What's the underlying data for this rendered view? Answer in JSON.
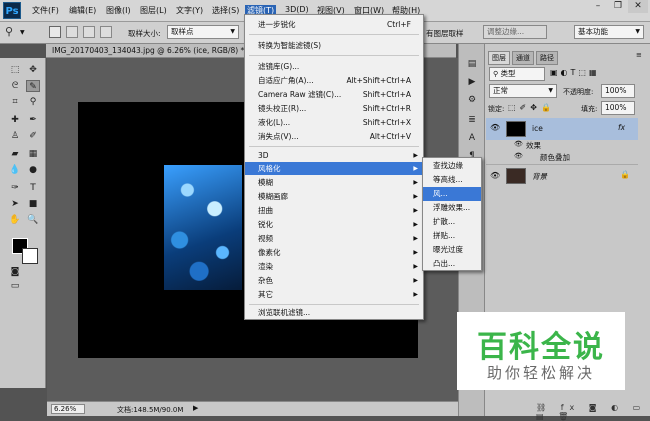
{
  "app": {
    "logo": "Ps"
  },
  "menubar": {
    "items": [
      "文件(F)",
      "编辑(E)",
      "图像(I)",
      "图层(L)",
      "文字(Y)",
      "选择(S)",
      "滤镜(T)",
      "3D(D)",
      "视图(V)",
      "窗口(W)",
      "帮助(H)"
    ],
    "active_index": 6,
    "window_controls": [
      "minimize-icon",
      "restore-icon",
      "close-icon"
    ]
  },
  "options_bar": {
    "sample_size_label": "取样大小:",
    "sample_size_value": "取样点",
    "all_layers_label": "有图层取样",
    "adjust_edge": "调整边缘...",
    "workspace": "基本功能"
  },
  "document": {
    "tab_title": "IMG_20170403_134043.jpg @ 6.26% (ice, RGB/8) *"
  },
  "status": {
    "zoom": "6.26%",
    "doc_info": "文档:148.5M/90.0M"
  },
  "filter_menu": {
    "items": [
      {
        "label": "进一步锐化",
        "shortcut": "Ctrl+F"
      },
      {
        "label": "转换为智能滤镜(S)",
        "shortcut": ""
      },
      {
        "label": "滤镜库(G)...",
        "shortcut": ""
      },
      {
        "label": "自适应广角(A)...",
        "shortcut": "Alt+Shift+Ctrl+A"
      },
      {
        "label": "Camera Raw 滤镜(C)...",
        "shortcut": "Shift+Ctrl+A"
      },
      {
        "label": "镜头校正(R)...",
        "shortcut": "Shift+Ctrl+R"
      },
      {
        "label": "液化(L)...",
        "shortcut": "Shift+Ctrl+X"
      },
      {
        "label": "消失点(V)...",
        "shortcut": "Alt+Ctrl+V"
      },
      {
        "label": "3D",
        "shortcut": ""
      },
      {
        "label": "风格化",
        "shortcut": ""
      },
      {
        "label": "模糊",
        "shortcut": ""
      },
      {
        "label": "模糊画廊",
        "shortcut": ""
      },
      {
        "label": "扭曲",
        "shortcut": ""
      },
      {
        "label": "锐化",
        "shortcut": ""
      },
      {
        "label": "视频",
        "shortcut": ""
      },
      {
        "label": "像素化",
        "shortcut": ""
      },
      {
        "label": "渲染",
        "shortcut": ""
      },
      {
        "label": "杂色",
        "shortcut": ""
      },
      {
        "label": "其它",
        "shortcut": ""
      },
      {
        "label": "浏览联机滤镜...",
        "shortcut": ""
      }
    ],
    "highlighted": "风格化"
  },
  "stylize_submenu": {
    "items": [
      "查找边缘",
      "等高线...",
      "风...",
      "浮雕效果...",
      "扩散...",
      "拼贴...",
      "曝光过度",
      "凸出..."
    ],
    "highlighted": "风..."
  },
  "layers_panel": {
    "tabs": [
      "图层",
      "通道",
      "路径"
    ],
    "kind_label": "类型",
    "blend_mode": "正常",
    "opacity_label": "不透明度:",
    "opacity": "100%",
    "lock_label": "锁定:",
    "fill_label": "填充:",
    "fill": "100%",
    "layers": [
      {
        "name": "ice",
        "fx": "fx",
        "selected": true
      },
      {
        "name": "效果",
        "sub": true
      },
      {
        "name": "颜色叠加",
        "sub": true
      },
      {
        "name": "背景",
        "locked": true
      }
    ]
  },
  "watermark": {
    "main": "百科全说",
    "sub": "助你轻松解决"
  }
}
